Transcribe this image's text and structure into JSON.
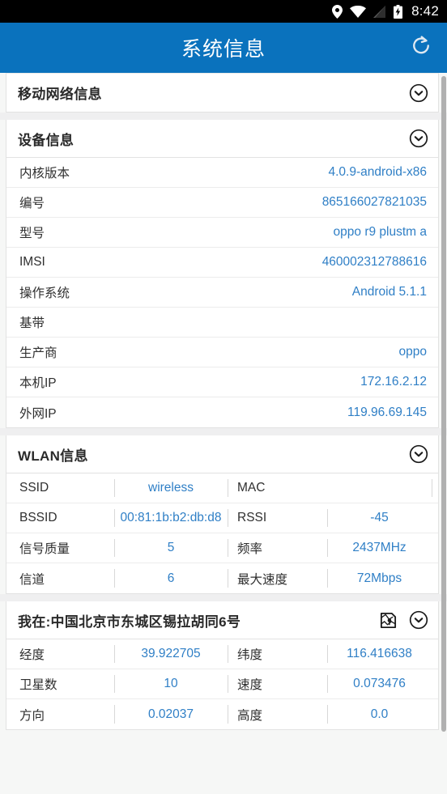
{
  "statusbar": {
    "time": "8:42",
    "icons": [
      "location-pin-icon",
      "wifi-icon",
      "cell-signal-icon",
      "battery-charging-icon"
    ]
  },
  "appbar": {
    "title": "系统信息",
    "refresh_icon": "refresh-icon",
    "bg_color": "#0a72bd"
  },
  "theme": {
    "value_color": "#2f7fc6",
    "label_color": "#2f2f2f",
    "page_bg": "#f6f7f6"
  },
  "sections": {
    "mobile_network": {
      "title": "移动网络信息",
      "expand_icon": "chevron-down-circle-icon"
    },
    "device": {
      "title": "设备信息",
      "expand_icon": "chevron-down-circle-icon",
      "rows": [
        {
          "label": "内核版本",
          "value": "4.0.9-android-x86"
        },
        {
          "label": "编号",
          "value": "865166027821035"
        },
        {
          "label": "型号",
          "value": "oppo r9 plustm a"
        },
        {
          "label": "IMSI",
          "value": "460002312788616"
        },
        {
          "label": "操作系统",
          "value": "Android 5.1.1"
        },
        {
          "label": "基带",
          "value": ""
        },
        {
          "label": "生产商",
          "value": "oppo"
        },
        {
          "label": "本机IP",
          "value": "172.16.2.12"
        },
        {
          "label": "外网IP",
          "value": "119.96.69.145"
        }
      ]
    },
    "wlan": {
      "title": "WLAN信息",
      "expand_icon": "chevron-down-circle-icon",
      "rows": [
        {
          "label1": "SSID",
          "value1": "wireless",
          "label2": "MAC",
          "value2": ""
        },
        {
          "label1": "BSSID",
          "value1": "00:81:1b:b2:db:d8",
          "label2": "RSSI",
          "value2": "-45"
        },
        {
          "label1": "信号质量",
          "value1": "5",
          "label2": "频率",
          "value2": "2437MHz"
        },
        {
          "label1": "信道",
          "value1": "6",
          "label2": "最大速度",
          "value2": "72Mbps"
        }
      ]
    },
    "location": {
      "title": "我在:中国北京市东城区锡拉胡同6号",
      "map_icon": "map-pin-icon",
      "expand_icon": "chevron-down-circle-icon",
      "rows": [
        {
          "label1": "经度",
          "value1": "39.922705",
          "label2": "纬度",
          "value2": "116.416638"
        },
        {
          "label1": "卫星数",
          "value1": "10",
          "label2": "速度",
          "value2": "0.073476"
        },
        {
          "label1": "方向",
          "value1": "0.02037",
          "label2": "高度",
          "value2": "0.0"
        }
      ]
    }
  }
}
